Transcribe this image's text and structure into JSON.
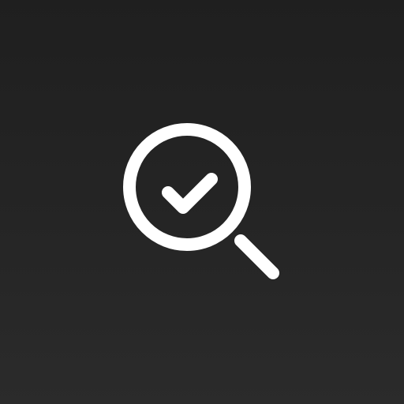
{
  "app_icon": {
    "icon": "search-check-icon",
    "background_color": "#262626",
    "glyph_color": "#ffffff"
  }
}
